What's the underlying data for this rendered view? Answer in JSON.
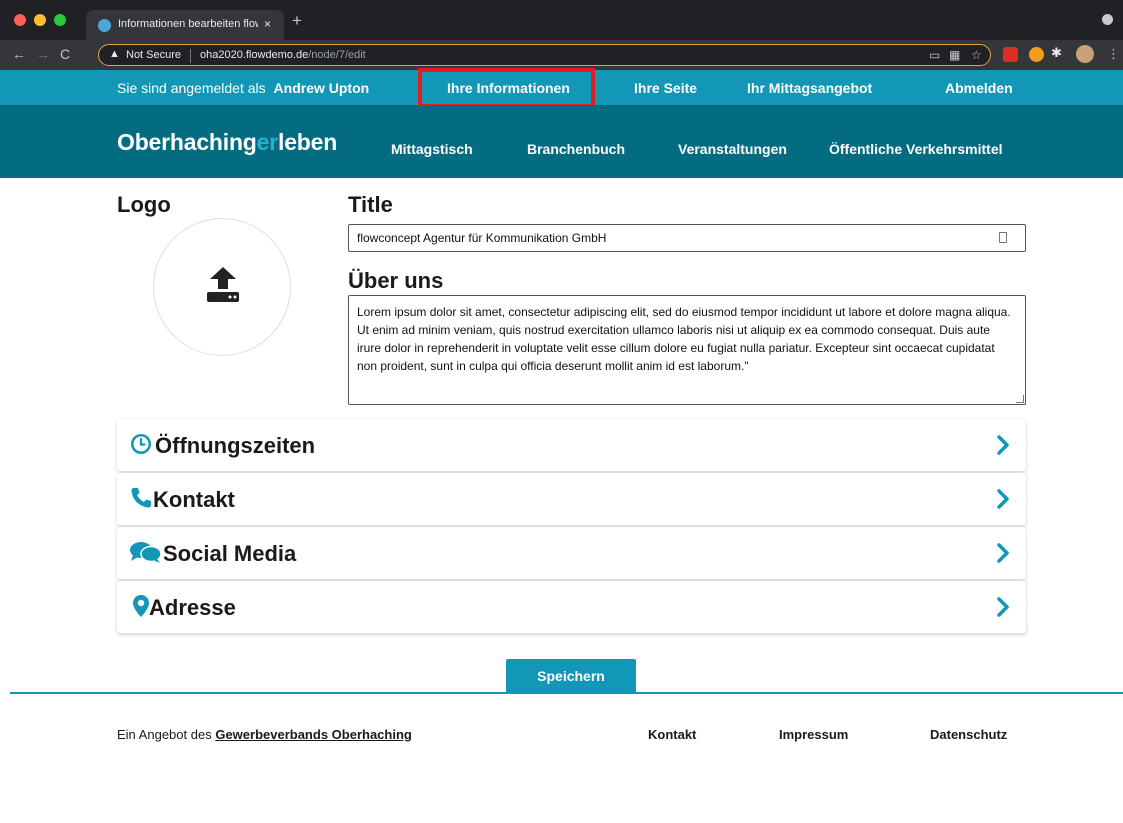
{
  "browser": {
    "tab_title": "Informationen bearbeiten flowc",
    "tab_close": "×",
    "new_tab": "+",
    "not_secure": "Not Secure",
    "url_host": "oha2020.flowdemo.de",
    "url_path": "/node/7/edit",
    "calendar_badge": "21"
  },
  "topbar": {
    "logged_in_prefix": "Sie sind angemeldet als",
    "user_name": "Andrew Upton",
    "links": [
      "Ihre Informationen",
      "Ihre Seite",
      "Ihr Mittagsangebot",
      "Abmelden"
    ]
  },
  "header": {
    "logo_part1": "Oberhaching",
    "logo_accent": "er",
    "logo_part2": "leben",
    "nav": [
      "Mittagstisch",
      "Branchenbuch",
      "Veranstaltungen",
      "Öffentliche Verkehrsmittel"
    ]
  },
  "form": {
    "logo_heading": "Logo",
    "title_heading": "Title",
    "title_value": "flowconcept Agentur für Kommunikation GmbH",
    "about_heading": "Über uns",
    "about_value": "Lorem ipsum dolor sit amet, consectetur adipiscing elit, sed do eiusmod tempor incididunt ut labore et dolore magna aliqua. Ut enim ad minim veniam, quis nostrud exercitation ullamco laboris nisi ut aliquip ex ea commodo consequat. Duis aute irure dolor in reprehenderit in voluptate velit esse cillum dolore eu fugiat nulla pariatur. Excepteur sint occaecat cupidatat non proident, sunt in culpa qui officia deserunt mollit anim id est laborum.\""
  },
  "sections": [
    {
      "label": "Öffnungszeiten",
      "icon": "clock-icon"
    },
    {
      "label": "Kontakt",
      "icon": "phone-icon"
    },
    {
      "label": "Social Media",
      "icon": "comments-icon"
    },
    {
      "label": "Adresse",
      "icon": "map-marker-icon"
    }
  ],
  "save_label": "Speichern",
  "footer": {
    "prefix": "Ein Angebot des",
    "org_link": "Gewerbeverbands Oberhaching",
    "links": [
      "Kontakt",
      "Impressum",
      "Datenschutz"
    ]
  },
  "colors": {
    "accent": "#1297b7",
    "header_bg": "#046c81",
    "logo_accent": "#27b0cf",
    "highlight": "#e31b23"
  }
}
